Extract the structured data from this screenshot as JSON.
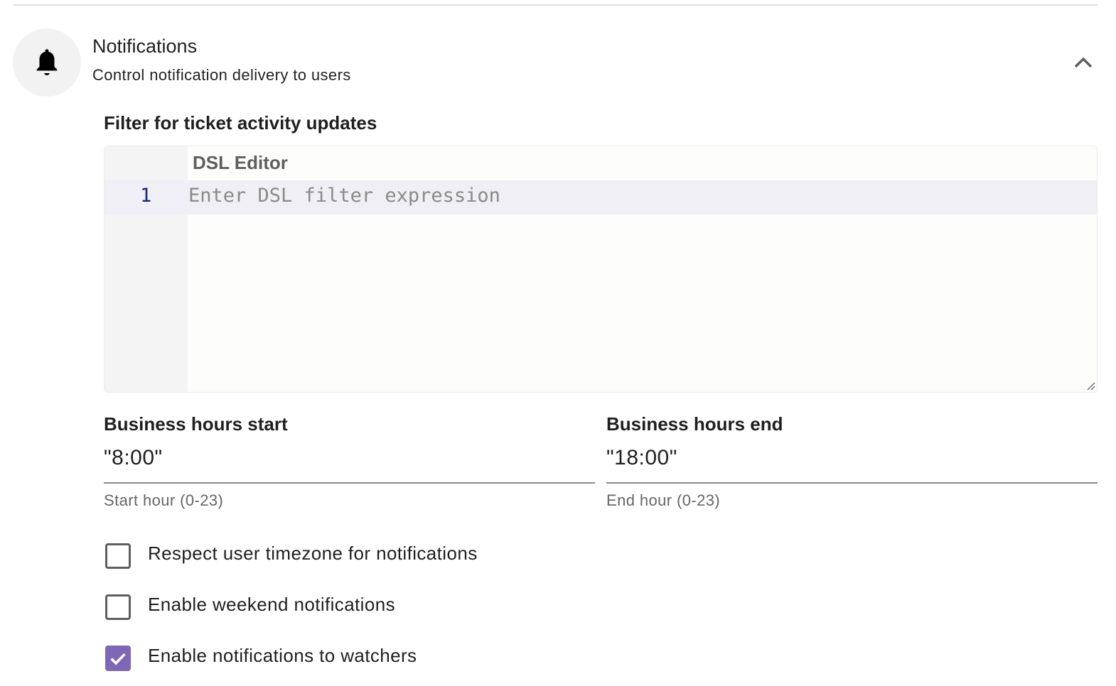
{
  "section": {
    "title": "Notifications",
    "subtitle": "Control notification delivery to users",
    "icon": "bell-icon",
    "expanded": true
  },
  "filter": {
    "label": "Filter for ticket activity updates",
    "editor_title": "DSL Editor",
    "line_number": "1",
    "placeholder": "Enter DSL filter expression"
  },
  "business_hours": {
    "start": {
      "label": "Business hours start",
      "value": "\"8:00\"",
      "helper": "Start hour (0-23)"
    },
    "end": {
      "label": "Business hours end",
      "value": "\"18:00\"",
      "helper": "End hour (0-23)"
    }
  },
  "checkboxes": [
    {
      "label": "Respect user timezone for notifications",
      "checked": false
    },
    {
      "label": "Enable weekend notifications",
      "checked": false
    },
    {
      "label": "Enable notifications to watchers",
      "checked": true
    }
  ],
  "colors": {
    "accent": "#7e68b6",
    "line_number": "#1a237e"
  }
}
